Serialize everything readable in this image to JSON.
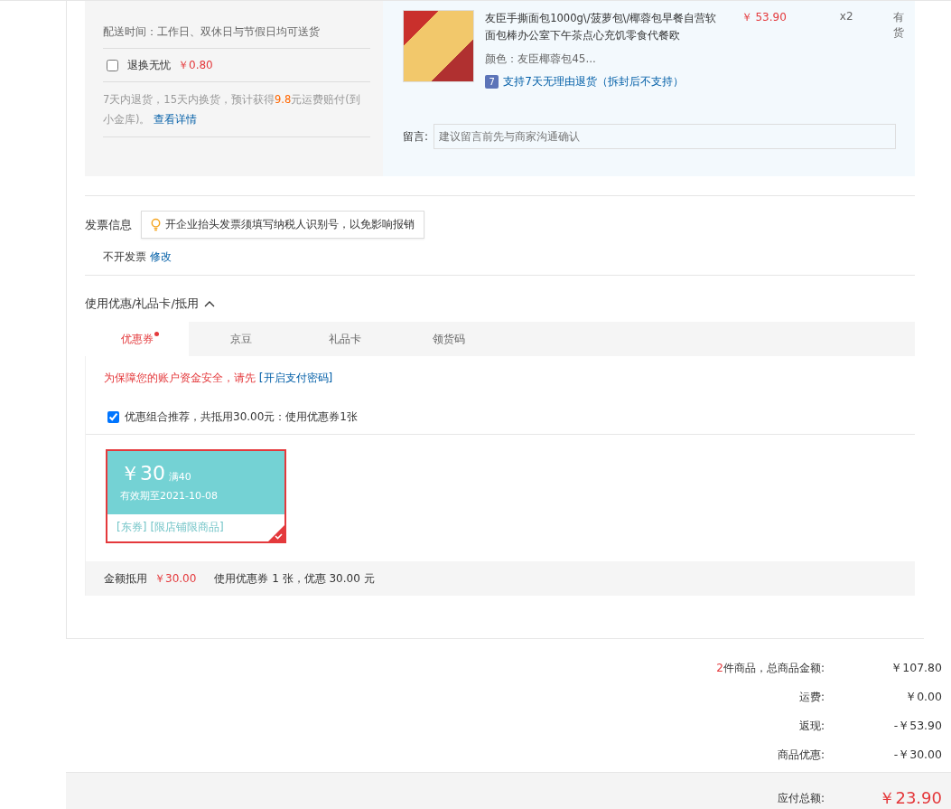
{
  "shipping": {
    "delivery_time": "配送时间：工作日、双休日与节假日均可送货",
    "service": {
      "label": "退换无忧",
      "price": "￥0.80",
      "checked": false
    },
    "service_note_before": "7天内退货，15天内换货，预计获得",
    "service_note_amount": "9.8",
    "service_note_after": "元运费赔付(到小金库)。",
    "details_link": "查看详情"
  },
  "product": {
    "title": "友臣手撕面包1000g\\/菠萝包\\/椰蓉包早餐自营软面包棒办公室下午茶点心充饥零食代餐欧",
    "price": "￥ 53.90",
    "quantity": "x2",
    "stock": "有货",
    "variant": "颜色：友臣椰蓉包45...",
    "return_badge": "7",
    "return_policy": "支持7天无理由退货（拆封后不支持）",
    "message_label": "留言:",
    "message_placeholder": "建议留言前先与商家沟通确认"
  },
  "invoice": {
    "title": "发票信息",
    "tip": "开企业抬头发票须填写纳税人识别号，以免影响报销",
    "status": "不开发票",
    "edit_link": "修改"
  },
  "discounts": {
    "title": "使用优惠/礼品卡/抵用",
    "expanded": true,
    "tabs": [
      {
        "label": "优惠券",
        "selected": true,
        "dot": true
      },
      {
        "label": "京豆",
        "selected": false,
        "dot": false
      },
      {
        "label": "礼品卡",
        "selected": false,
        "dot": false
      },
      {
        "label": "领货码",
        "selected": false,
        "dot": false
      }
    ],
    "security_note": "为保障您的账户资金安全，请先",
    "security_link": "[开启支付密码]",
    "recommend": {
      "label": "优惠组合推荐，共抵用30.00元：使用优惠券1张",
      "checked": true
    },
    "coupons": [
      {
        "amount": "￥30",
        "condition": "满40",
        "validity": "有效期至2021-10-08",
        "tags": [
          "[东券]",
          "[限店铺限商品]"
        ],
        "selected": true
      }
    ],
    "summary_label": "金额抵用",
    "summary_amount": "￥30.00",
    "summary_detail": "使用优惠券 1 张，优惠 30.00 元"
  },
  "totals": {
    "rows": [
      {
        "count": "2",
        "label": "件商品，总商品金额:",
        "value": "￥107.80"
      },
      {
        "label": "运费:",
        "value": "￥0.00"
      },
      {
        "label": "返现:",
        "value": "-￥53.90"
      },
      {
        "label": "商品优惠:",
        "value": "-￥30.00"
      }
    ],
    "payable_label": "应付总额:",
    "payable_value": "￥23.90"
  }
}
